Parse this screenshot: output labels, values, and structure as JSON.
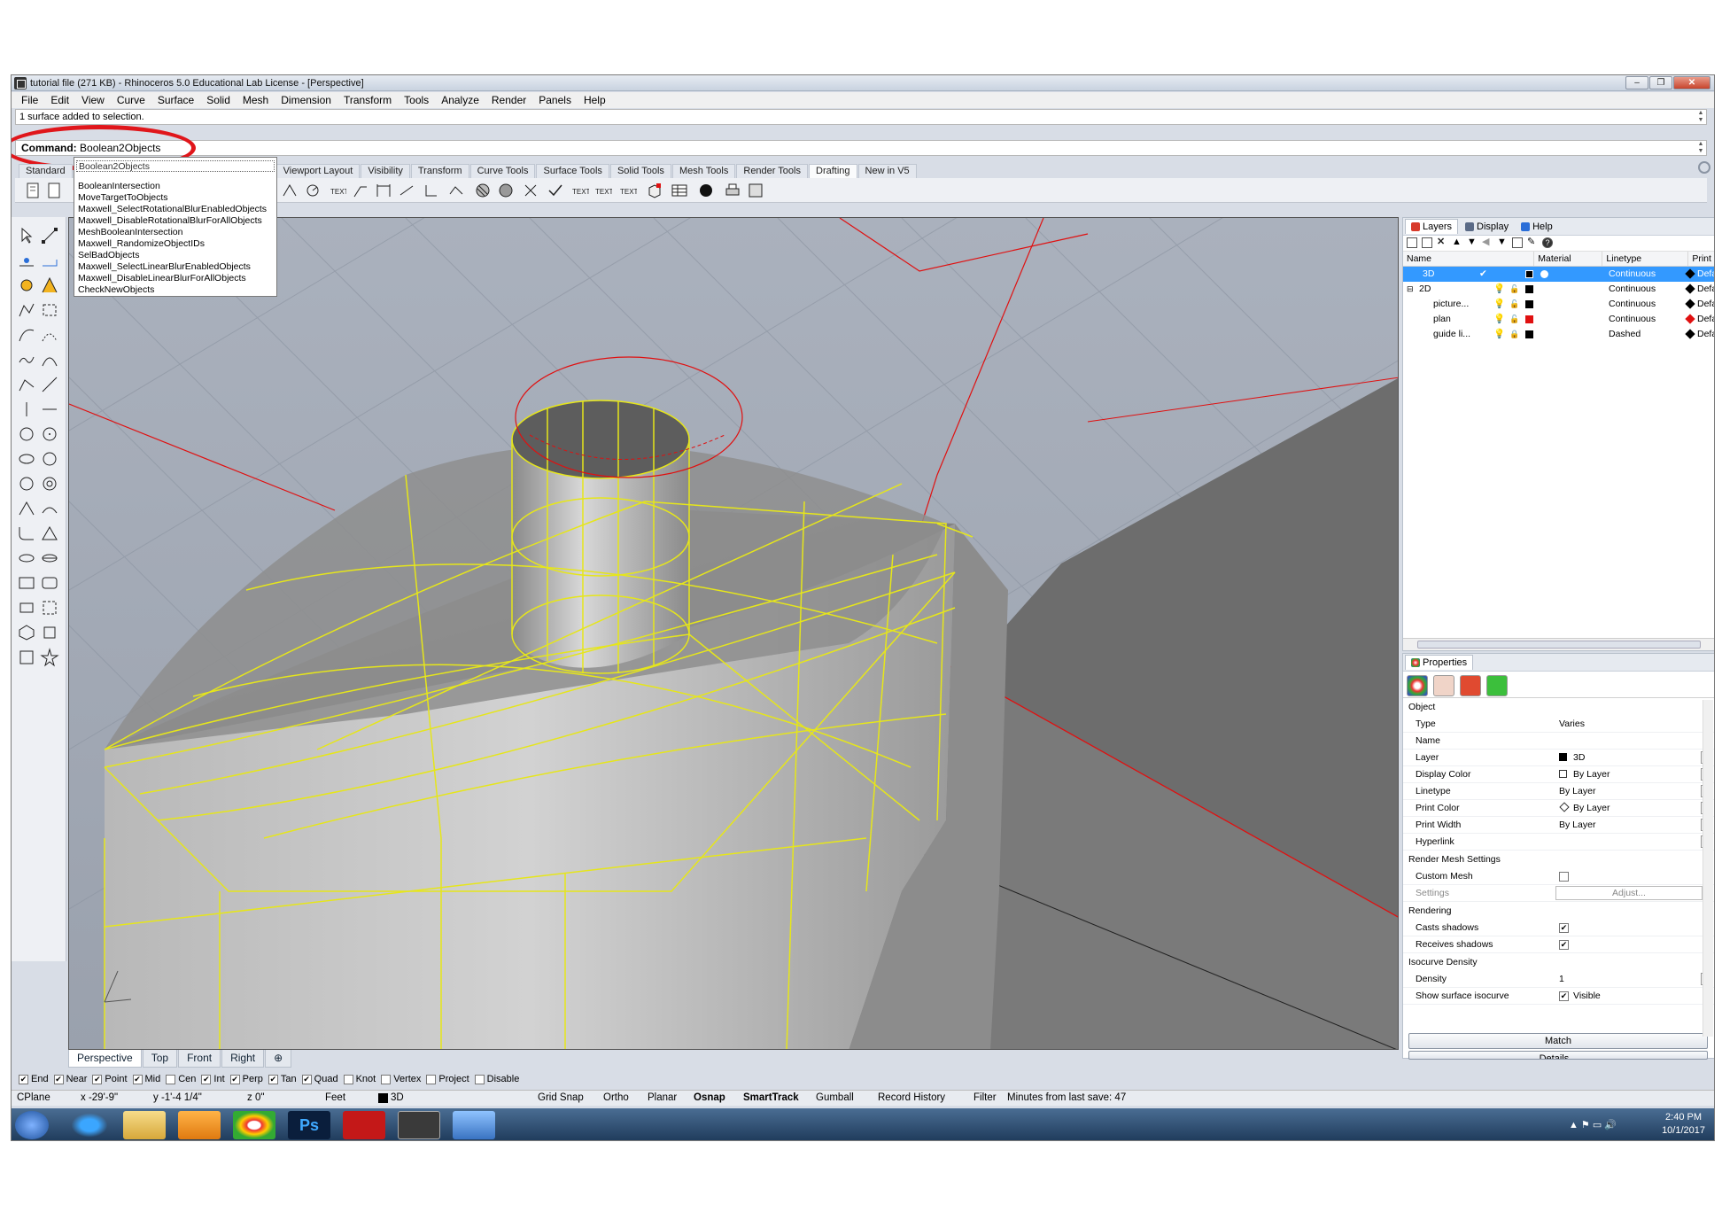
{
  "window": {
    "title": "tutorial file (271 KB) - Rhinoceros 5.0 Educational Lab License - [Perspective]"
  },
  "menu": [
    "File",
    "Edit",
    "View",
    "Curve",
    "Surface",
    "Solid",
    "Mesh",
    "Dimension",
    "Transform",
    "Tools",
    "Analyze",
    "Render",
    "Panels",
    "Help"
  ],
  "command": {
    "history": "1 surface added to selection.",
    "label": "Command:",
    "value": "Boolean2Objects"
  },
  "autocomplete": {
    "first": "Boolean2Objects",
    "items": [
      "BooleanIntersection",
      "MoveTargetToObjects",
      "Maxwell_SelectRotationalBlurEnabledObjects",
      "Maxwell_DisableRotationalBlurForAllObjects",
      "MeshBooleanIntersection",
      "Maxwell_RandomizeObjectIDs",
      "SelBadObjects",
      "Maxwell_SelectLinearBlurEnabledObjects",
      "Maxwell_DisableLinearBlurForAllObjects",
      "CheckNewObjects"
    ]
  },
  "toolbar_tabs": [
    "Standard",
    "Viewport Layout",
    "Visibility",
    "Transform",
    "Curve Tools",
    "Surface Tools",
    "Solid Tools",
    "Mesh Tools",
    "Render Tools",
    "Drafting",
    "New in V5"
  ],
  "toolbar_active_tab": "Drafting",
  "viewport_tabs": [
    "Perspective",
    "Top",
    "Front",
    "Right"
  ],
  "layers_panel": {
    "tabs": [
      "Layers",
      "Display",
      "Help"
    ],
    "headers": [
      "Name",
      "Material",
      "Linetype",
      "Print W"
    ],
    "rows": [
      {
        "name": "3D",
        "linetype": "Continuous",
        "print": "Defau",
        "color": "#000000"
      },
      {
        "name": "2D",
        "linetype": "Continuous",
        "print": "Default",
        "color": "#000000"
      },
      {
        "name": "picture...",
        "linetype": "Continuous",
        "print": "Default",
        "color": "#000000"
      },
      {
        "name": "plan",
        "linetype": "Continuous",
        "print": "Default",
        "color": "#e01010"
      },
      {
        "name": "guide li...",
        "linetype": "Dashed",
        "print": "Default",
        "color": "#000000"
      }
    ]
  },
  "properties_panel": {
    "title": "Properties",
    "section_object": "Object",
    "rows": [
      {
        "k": "Type",
        "v": "Varies"
      },
      {
        "k": "Name",
        "v": ""
      },
      {
        "k": "Layer",
        "v": "3D"
      },
      {
        "k": "Display Color",
        "v": "By Layer"
      },
      {
        "k": "Linetype",
        "v": "By Layer"
      },
      {
        "k": "Print Color",
        "v": "By Layer"
      },
      {
        "k": "Print Width",
        "v": "By Layer"
      },
      {
        "k": "Hyperlink",
        "v": ""
      }
    ],
    "section_mesh": "Render Mesh Settings",
    "custom_mesh": "Custom Mesh",
    "settings": "Settings",
    "adjust": "Adjust...",
    "section_render": "Rendering",
    "casts": "Casts shadows",
    "receives": "Receives shadows",
    "section_iso": "Isocurve Density",
    "density_label": "Density",
    "density_value": "1",
    "show_iso": "Show surface isocurve",
    "visible": "Visible",
    "match": "Match",
    "details": "Details..."
  },
  "osnaps": [
    {
      "label": "End",
      "on": true
    },
    {
      "label": "Near",
      "on": true
    },
    {
      "label": "Point",
      "on": true
    },
    {
      "label": "Mid",
      "on": true
    },
    {
      "label": "Cen",
      "on": false
    },
    {
      "label": "Int",
      "on": true
    },
    {
      "label": "Perp",
      "on": true
    },
    {
      "label": "Tan",
      "on": true
    },
    {
      "label": "Quad",
      "on": true
    },
    {
      "label": "Knot",
      "on": false
    },
    {
      "label": "Vertex",
      "on": false
    },
    {
      "label": "Project",
      "on": false
    },
    {
      "label": "Disable",
      "on": false
    }
  ],
  "status": {
    "cplane": "CPlane",
    "x": "x -29'-9\"",
    "y": "y -1'-4 1/4\"",
    "z": "z 0\"",
    "units": "Feet",
    "layer": "3D",
    "grid_snap": "Grid Snap",
    "ortho": "Ortho",
    "planar": "Planar",
    "osnap": "Osnap",
    "smarttrack": "SmartTrack",
    "gumball": "Gumball",
    "record": "Record History",
    "filter": "Filter",
    "save": "Minutes from last save: 47"
  },
  "taskbar": {
    "time": "2:40 PM",
    "date": "10/1/2017",
    "ps": "Ps"
  },
  "colors": {
    "selection": "#3399ff",
    "wire": "#e6e61a",
    "red_line": "#e01010",
    "annotation": "#e0161b"
  }
}
